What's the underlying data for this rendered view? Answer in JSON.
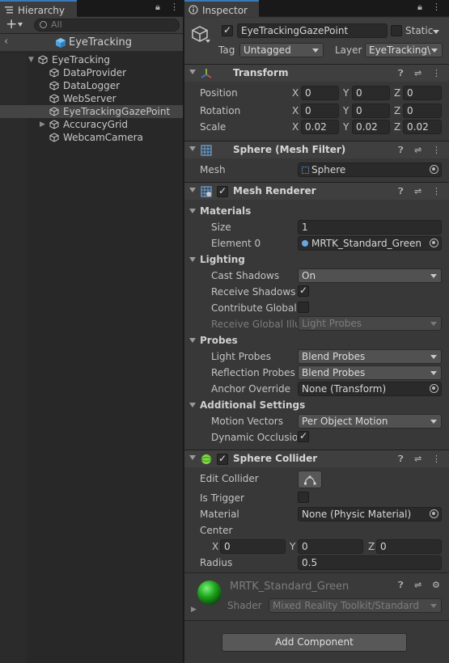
{
  "hierarchy": {
    "tab_label": "Hierarchy",
    "add_label": "+",
    "search_placeholder": "All",
    "scene_name": "EyeTracking",
    "items": [
      {
        "label": "EyeTracking",
        "indent": 0
      },
      {
        "label": "DataProvider",
        "indent": 1
      },
      {
        "label": "DataLogger",
        "indent": 1
      },
      {
        "label": "WebServer",
        "indent": 1
      },
      {
        "label": "EyeTrackingGazePoint",
        "indent": 1,
        "selected": true
      },
      {
        "label": "AccuracyGrid",
        "indent": 1,
        "collapsed": true
      },
      {
        "label": "WebcamCamera",
        "indent": 1
      }
    ]
  },
  "inspector": {
    "tab_label": "Inspector",
    "object_name": "EyeTrackingGazePoint",
    "static_label": "Static",
    "tag_label": "Tag",
    "tag_value": "Untagged",
    "layer_label": "Layer",
    "layer_value": "EyeTracking\\",
    "transform": {
      "title": "Transform",
      "position_label": "Position",
      "rotation_label": "Rotation",
      "scale_label": "Scale",
      "position": {
        "x": "0",
        "y": "0",
        "z": "0"
      },
      "rotation": {
        "x": "0",
        "y": "0",
        "z": "0"
      },
      "scale": {
        "x": "0.02",
        "y": "0.02",
        "z": "0.02"
      }
    },
    "mesh_filter": {
      "title": "Sphere (Mesh Filter)",
      "mesh_label": "Mesh",
      "mesh_value": "Sphere"
    },
    "mesh_renderer": {
      "title": "Mesh Renderer",
      "materials_label": "Materials",
      "size_label": "Size",
      "size_value": "1",
      "element0_label": "Element 0",
      "element0_value": "MRTK_Standard_Green",
      "lighting_label": "Lighting",
      "cast_shadows_label": "Cast Shadows",
      "cast_shadows_value": "On",
      "receive_shadows_label": "Receive Shadows",
      "contribute_gi_label": "Contribute Global I",
      "receive_gi_label": "Receive Global Illu",
      "receive_gi_value": "Light Probes",
      "probes_label": "Probes",
      "light_probes_label": "Light Probes",
      "light_probes_value": "Blend Probes",
      "reflection_probes_label": "Reflection Probes",
      "reflection_probes_value": "Blend Probes",
      "anchor_override_label": "Anchor Override",
      "anchor_override_value": "None (Transform)",
      "additional_label": "Additional Settings",
      "motion_vectors_label": "Motion Vectors",
      "motion_vectors_value": "Per Object Motion",
      "dynamic_occlusion_label": "Dynamic Occlusion"
    },
    "sphere_collider": {
      "title": "Sphere Collider",
      "edit_collider_label": "Edit Collider",
      "is_trigger_label": "Is Trigger",
      "material_label": "Material",
      "material_value": "None (Physic Material)",
      "center_label": "Center",
      "center": {
        "x": "0",
        "y": "0",
        "z": "0"
      },
      "radius_label": "Radius",
      "radius_value": "0.5"
    },
    "material": {
      "name": "MRTK_Standard_Green",
      "shader_label": "Shader",
      "shader_value": "Mixed Reality Toolkit/Standard"
    },
    "add_component_label": "Add Component",
    "axis_labels": {
      "x": "X",
      "y": "Y",
      "z": "Z"
    }
  },
  "colors": {
    "selection": "#444444",
    "accent": "#3a79bb",
    "sphere_green": "#1fa81f"
  }
}
